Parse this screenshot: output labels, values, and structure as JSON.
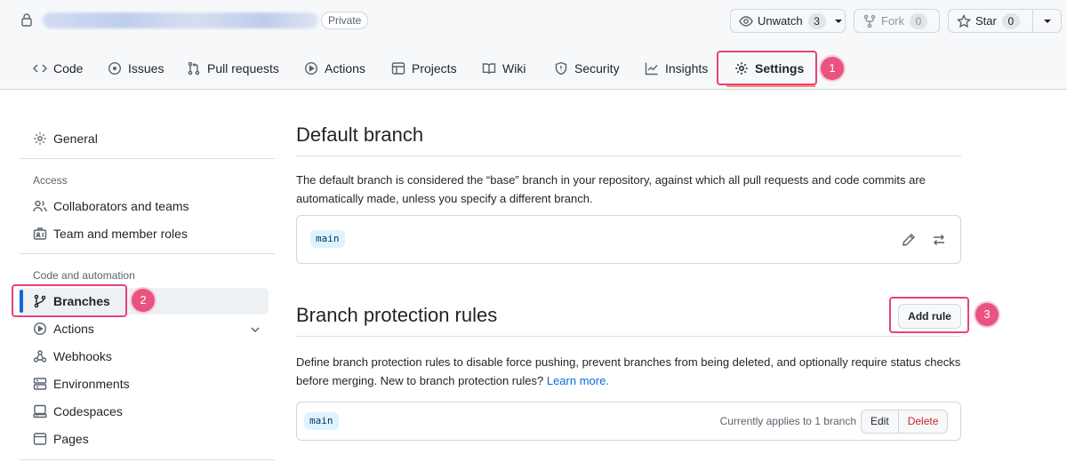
{
  "repo": {
    "visibility_badge": "Private"
  },
  "header_actions": {
    "unwatch": {
      "label": "Unwatch",
      "count": "3"
    },
    "fork": {
      "label": "Fork",
      "count": "0"
    },
    "star": {
      "label": "Star",
      "count": "0"
    }
  },
  "tabs": [
    {
      "label": "Code",
      "icon": "code-icon"
    },
    {
      "label": "Issues",
      "icon": "issue-icon"
    },
    {
      "label": "Pull requests",
      "icon": "pull-request-icon"
    },
    {
      "label": "Actions",
      "icon": "play-icon"
    },
    {
      "label": "Projects",
      "icon": "table-icon"
    },
    {
      "label": "Wiki",
      "icon": "book-icon"
    },
    {
      "label": "Security",
      "icon": "shield-icon"
    },
    {
      "label": "Insights",
      "icon": "graph-icon"
    },
    {
      "label": "Settings",
      "icon": "gear-icon",
      "selected": true
    }
  ],
  "steps": [
    "1",
    "2",
    "3"
  ],
  "sidebar": {
    "general": "General",
    "access_heading": "Access",
    "access_items": [
      "Collaborators and teams",
      "Team and member roles"
    ],
    "code_heading": "Code and automation",
    "code_items": [
      "Branches",
      "Actions",
      "Webhooks",
      "Environments",
      "Codespaces",
      "Pages"
    ]
  },
  "default_branch": {
    "title": "Default branch",
    "description": "The default branch is considered the “base” branch in your repository, against which all pull requests and code commits are automatically made, unless you specify a different branch.",
    "branch": "main"
  },
  "protection": {
    "title": "Branch protection rules",
    "add_rule": "Add rule",
    "description": "Define branch protection rules to disable force pushing, prevent branches from being deleted, and optionally require status checks before merging. New to branch protection rules?",
    "learn_more": "Learn more.",
    "rule_branch": "main",
    "applies_text": "Currently applies to 1 branch",
    "edit": "Edit",
    "delete": "Delete"
  },
  "colors": {
    "accent": "#0969da",
    "highlight": "#e5437a",
    "danger": "#cf222e",
    "tab_underline": "#fd8c73"
  }
}
